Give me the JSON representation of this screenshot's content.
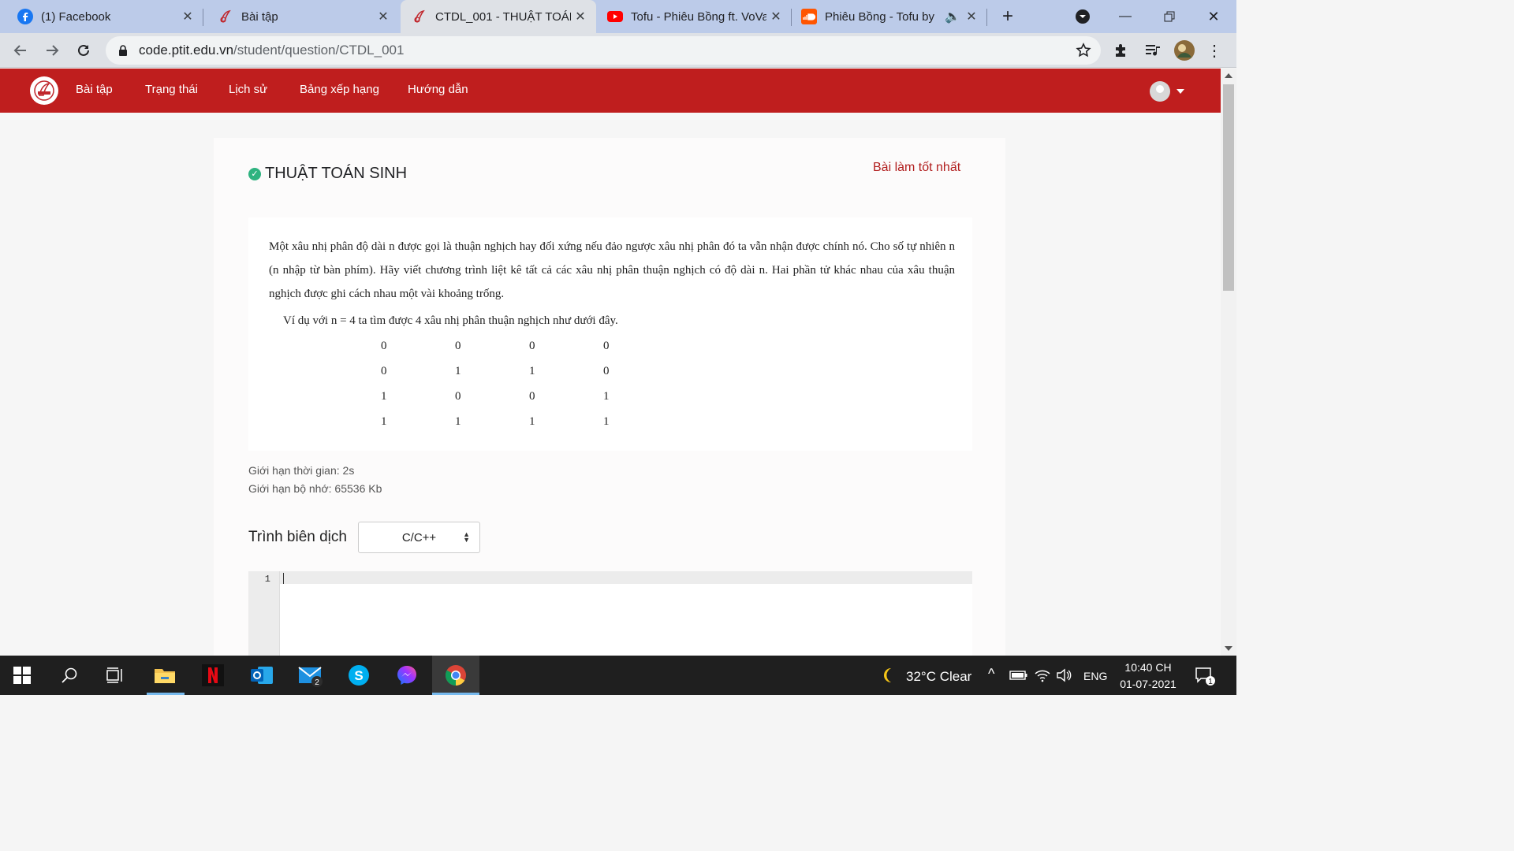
{
  "browser": {
    "tabs": [
      {
        "title": "(1) Facebook",
        "icon": "facebook-icon"
      },
      {
        "title": "Bài tập",
        "icon": "ptit-icon"
      },
      {
        "title": "CTDL_001 - THUẬT TOÁN",
        "icon": "ptit-icon",
        "active": true
      },
      {
        "title": "Tofu - Phiêu Bồng ft. VoVa",
        "icon": "youtube-icon"
      },
      {
        "title": "Phiêu Bồng - Tofu by",
        "icon": "soundcloud-icon"
      }
    ],
    "url_host": "code.ptit.edu.vn",
    "url_path": "/student/question/CTDL_001"
  },
  "site": {
    "nav": [
      "Bài tập",
      "Trạng thái",
      "Lịch sử",
      "Bảng xếp hạng",
      "Hướng dẫn"
    ],
    "brand_color": "#bf1e1e"
  },
  "question": {
    "title": "THUẬT TOÁN SINH",
    "best_link": "Bài làm tốt nhất",
    "statement_lines": [
      "Một xâu nhị phân độ dài n được gọi là thuận nghịch hay đối xứng nếu đảo ngược xâu nhị phân đó ta vẫn nhận được chính nó. Cho số tự nhiên n (n nhập từ bàn phím). Hãy viết chương trình liệt kê tất cả các xâu nhị phân thuận nghịch có độ dài n.  Hai phần tử khác nhau của xâu thuận nghịch được ghi cách nhau một vài khoảng trống.",
      "Ví dụ với n = 4 ta tìm được 4 xâu nhị phân thuận nghịch như dưới đây."
    ],
    "example": [
      [
        "0",
        "0",
        "0",
        "0"
      ],
      [
        "0",
        "1",
        "1",
        "0"
      ],
      [
        "1",
        "0",
        "0",
        "1"
      ],
      [
        "1",
        "1",
        "1",
        "1"
      ]
    ],
    "time_limit": "Giới hạn thời gian: 2s",
    "memory_limit": "Giới hạn bộ nhớ: 65536 Kb",
    "compiler_label": "Trình biên dịch",
    "compiler_value": "C/C++",
    "editor_line": "1"
  },
  "chat_badge": "1",
  "taskbar": {
    "weather": "32°C  Clear",
    "lang": "ENG",
    "time": "10:40 CH",
    "date": "01-07-2021",
    "mail_badge": "2",
    "notif_badge": "1"
  }
}
